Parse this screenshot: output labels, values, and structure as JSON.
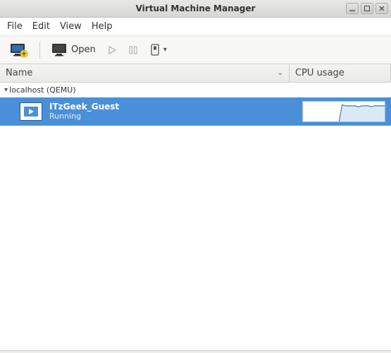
{
  "window": {
    "title": "Virtual Machine Manager"
  },
  "menus": {
    "file": "File",
    "edit": "Edit",
    "view": "View",
    "help": "Help"
  },
  "toolbar": {
    "open_label": "Open"
  },
  "columns": {
    "name": "Name",
    "cpu": "CPU usage"
  },
  "host": {
    "label": "localhost (QEMU)"
  },
  "vms": [
    {
      "name": "ITzGeek_Guest",
      "state": "Running"
    }
  ],
  "chart_data": {
    "type": "area",
    "title": "CPU usage",
    "xlabel": "",
    "ylabel": "",
    "ylim": [
      0,
      100
    ],
    "series": [
      {
        "name": "ITzGeek_Guest",
        "values": [
          0,
          0,
          0,
          0,
          0,
          0,
          0,
          0,
          0,
          0,
          0,
          0,
          85,
          80,
          80,
          80,
          80,
          75,
          80,
          80,
          80,
          76,
          80,
          80,
          80,
          80
        ]
      }
    ]
  }
}
